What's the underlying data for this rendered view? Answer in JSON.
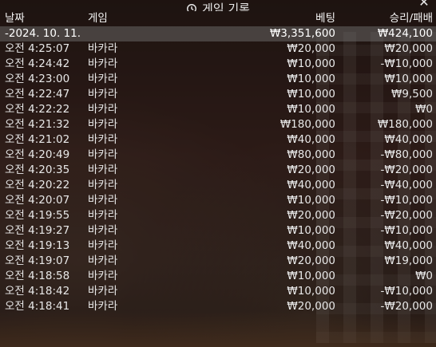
{
  "header": {
    "title": "게임 기록",
    "columns": {
      "date": "날짜",
      "game": "게임",
      "bet": "베팅",
      "win_loss": "승리/패배"
    }
  },
  "summary": {
    "date": "-2024. 10. 11.",
    "bet": "₩3,351,600",
    "win_loss": "₩424,100"
  },
  "rows": [
    {
      "time": "오전 4:25:07",
      "game": "바카라",
      "bet": "₩20,000",
      "win_loss": "₩20,000"
    },
    {
      "time": "오전 4:24:42",
      "game": "바카라",
      "bet": "₩10,000",
      "win_loss": "-₩10,000"
    },
    {
      "time": "오전 4:23:00",
      "game": "바카라",
      "bet": "₩10,000",
      "win_loss": "₩10,000"
    },
    {
      "time": "오전 4:22:47",
      "game": "바카라",
      "bet": "₩10,000",
      "win_loss": "₩9,500"
    },
    {
      "time": "오전 4:22:22",
      "game": "바카라",
      "bet": "₩10,000",
      "win_loss": "₩0"
    },
    {
      "time": "오전 4:21:32",
      "game": "바카라",
      "bet": "₩180,000",
      "win_loss": "₩180,000"
    },
    {
      "time": "오전 4:21:02",
      "game": "바카라",
      "bet": "₩40,000",
      "win_loss": "₩40,000"
    },
    {
      "time": "오전 4:20:49",
      "game": "바카라",
      "bet": "₩80,000",
      "win_loss": "-₩80,000"
    },
    {
      "time": "오전 4:20:35",
      "game": "바카라",
      "bet": "₩20,000",
      "win_loss": "-₩20,000"
    },
    {
      "time": "오전 4:20:22",
      "game": "바카라",
      "bet": "₩40,000",
      "win_loss": "-₩40,000"
    },
    {
      "time": "오전 4:20:07",
      "game": "바카라",
      "bet": "₩10,000",
      "win_loss": "-₩10,000"
    },
    {
      "time": "오전 4:19:55",
      "game": "바카라",
      "bet": "₩20,000",
      "win_loss": "-₩20,000"
    },
    {
      "time": "오전 4:19:27",
      "game": "바카라",
      "bet": "₩10,000",
      "win_loss": "-₩10,000"
    },
    {
      "time": "오전 4:19:13",
      "game": "바카라",
      "bet": "₩40,000",
      "win_loss": "₩40,000"
    },
    {
      "time": "오전 4:19:07",
      "game": "바카라",
      "bet": "₩20,000",
      "win_loss": "₩19,000"
    },
    {
      "time": "오전 4:18:58",
      "game": "바카라",
      "bet": "₩10,000",
      "win_loss": "₩0"
    },
    {
      "time": "오전 4:18:42",
      "game": "바카라",
      "bet": "₩10,000",
      "win_loss": "-₩10,000"
    },
    {
      "time": "오전 4:18:41",
      "game": "바카라",
      "bet": "₩20,000",
      "win_loss": "-₩20,000"
    }
  ],
  "icons": {
    "title": "history-icon",
    "close": "close-icon"
  }
}
